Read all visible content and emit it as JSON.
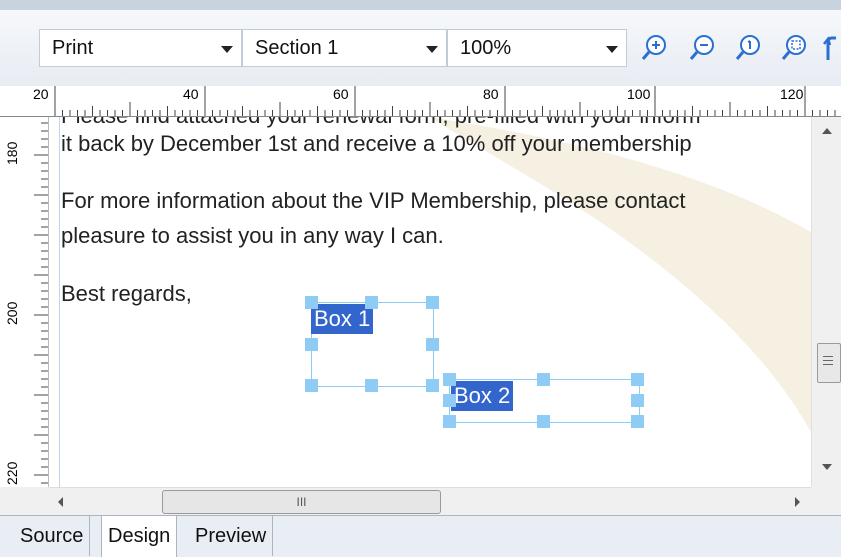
{
  "toolbar": {
    "view_select": "Print",
    "section_select": "Section 1",
    "zoom_select": "100%"
  },
  "ruler": {
    "horizontal_ticks": [
      "20",
      "40",
      "60",
      "80",
      "100",
      "120"
    ],
    "vertical_ticks": [
      "180",
      "200",
      "220"
    ]
  },
  "document": {
    "line1": "Please find attached your renewal form, pre-filled with your inform",
    "line2": "it back by December 1st and receive a 10% off your membership",
    "line3": "For more information about the VIP Membership, please contact",
    "line4": "pleasure to assist you in any way I can.",
    "line5": "Best regards,"
  },
  "boxes": {
    "box1_label": "Box 1",
    "box2_label": "Box 2"
  },
  "scrollbar": {
    "thumb_grip": "III"
  },
  "tabs": [
    "Source",
    "Design",
    "Preview"
  ],
  "colors": {
    "selection": "#3366cc",
    "handle": "#8ecbf5",
    "watermark": "#f6f0e2"
  }
}
